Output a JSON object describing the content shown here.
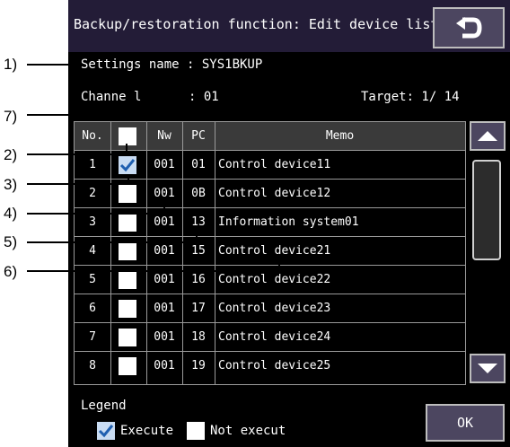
{
  "window": {
    "title": "Backup/restoration function: Edit device list"
  },
  "info": {
    "settings_name": "Settings name : SYS1BKUP",
    "channel_label": "Channe l",
    "channel_value": ": 01",
    "target": "Target:  1/ 14"
  },
  "table": {
    "headers": {
      "no": "No.",
      "nw": "Nw",
      "pc": "PC",
      "memo": "Memo"
    },
    "rows": [
      {
        "no": "1",
        "nw": "001",
        "pc": "01",
        "memo": "Control device11",
        "checked": true
      },
      {
        "no": "2",
        "nw": "001",
        "pc": "0B",
        "memo": "Control device12",
        "checked": false
      },
      {
        "no": "3",
        "nw": "001",
        "pc": "13",
        "memo": "Information system01",
        "checked": false
      },
      {
        "no": "4",
        "nw": "001",
        "pc": "15",
        "memo": "Control device21",
        "checked": false
      },
      {
        "no": "5",
        "nw": "001",
        "pc": "16",
        "memo": "Control device22",
        "checked": false
      },
      {
        "no": "6",
        "nw": "001",
        "pc": "17",
        "memo": "Control device23",
        "checked": false
      },
      {
        "no": "7",
        "nw": "001",
        "pc": "18",
        "memo": "Control device24",
        "checked": false
      },
      {
        "no": "8",
        "nw": "001",
        "pc": "19",
        "memo": "Control device25",
        "checked": false
      }
    ]
  },
  "legend": {
    "title": "Legend",
    "execute": "Execute",
    "not_execute": "Not execut"
  },
  "buttons": {
    "ok": "OK"
  },
  "callouts": {
    "c1": "1)",
    "c2": "2)",
    "c3": "3)",
    "c4": "4)",
    "c5": "5)",
    "c6": "6)",
    "c7": "7)"
  },
  "colors": {
    "title_bar": "#231c37",
    "background": "#000000",
    "button": "#4c4660",
    "check": "#1f5fb0"
  },
  "icons": {
    "back": "return-arrow-icon",
    "up": "triangle-up-icon",
    "down": "triangle-down-icon",
    "check": "check-mark-icon"
  }
}
